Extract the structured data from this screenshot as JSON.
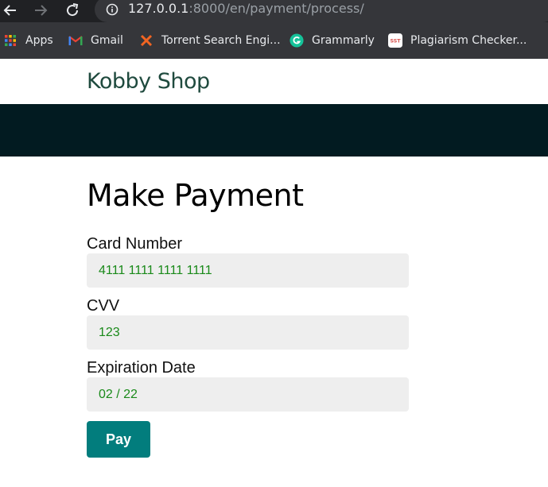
{
  "browser": {
    "url_host": "127.0.0.1",
    "url_rest": ":8000/en/payment/process/"
  },
  "bookmarks": [
    {
      "label": "Apps",
      "icon": "apps-grid-icon"
    },
    {
      "label": "Gmail",
      "icon": "gmail-icon"
    },
    {
      "label": "Torrent Search Engi...",
      "icon": "torrent-x-icon"
    },
    {
      "label": "Grammarly",
      "icon": "grammarly-icon"
    },
    {
      "label": "Plagiarism Checker...",
      "icon": "sst-icon"
    }
  ],
  "sst_badge": "SST",
  "site": {
    "logo": "Kobby Shop"
  },
  "form": {
    "title": "Make Payment",
    "card_label": "Card Number",
    "card_value": "4111 1111 1111 1111",
    "cvv_label": "CVV",
    "cvv_value": "123",
    "exp_label": "Expiration Date",
    "exp_value": "02 / 22",
    "pay_label": "Pay"
  },
  "colors": {
    "accent": "#027d7d",
    "header_band": "#021b21",
    "field_text": "#1a8a1a"
  }
}
